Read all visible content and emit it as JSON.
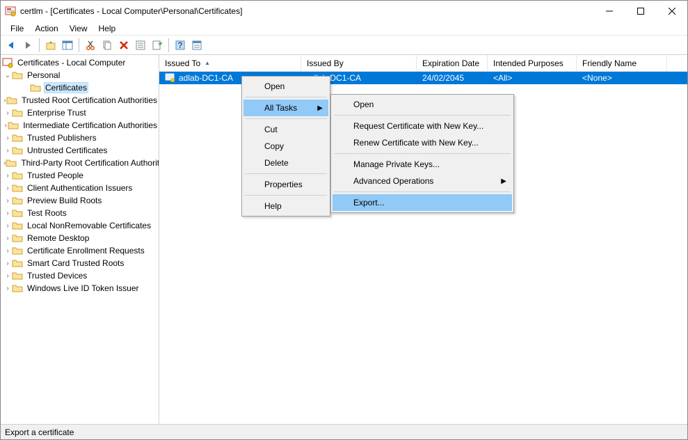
{
  "window": {
    "title": "certlm - [Certificates - Local Computer\\Personal\\Certificates]"
  },
  "menus": {
    "file": "File",
    "action": "Action",
    "view": "View",
    "help": "Help"
  },
  "tree": {
    "root": "Certificates - Local Computer",
    "personal": "Personal",
    "personal_certs": "Certificates",
    "items": [
      "Trusted Root Certification Authorities",
      "Enterprise Trust",
      "Intermediate Certification Authorities",
      "Trusted Publishers",
      "Untrusted Certificates",
      "Third-Party Root Certification Authorities",
      "Trusted People",
      "Client Authentication Issuers",
      "Preview Build Roots",
      "Test Roots",
      "Local NonRemovable Certificates",
      "Remote Desktop",
      "Certificate Enrollment Requests",
      "Smart Card Trusted Roots",
      "Trusted Devices",
      "Windows Live ID Token Issuer"
    ]
  },
  "columns": {
    "issued_to": "Issued To",
    "issued_by": "Issued By",
    "expiration": "Expiration Date",
    "purposes": "Intended Purposes",
    "friendly": "Friendly Name"
  },
  "row": {
    "issued_to": "adlab-DC1-CA",
    "issued_by": "adlab-DC1-CA",
    "expiration": "24/02/2045",
    "purposes": "<All>",
    "friendly": "<None>"
  },
  "ctx1": {
    "open": "Open",
    "all_tasks": "All Tasks",
    "cut": "Cut",
    "copy": "Copy",
    "delete": "Delete",
    "properties": "Properties",
    "help": "Help"
  },
  "ctx2": {
    "open": "Open",
    "req_new": "Request Certificate with New Key...",
    "renew_new": "Renew Certificate with New Key...",
    "manage_keys": "Manage Private Keys...",
    "adv_ops": "Advanced Operations",
    "export": "Export..."
  },
  "status": "Export a certificate"
}
